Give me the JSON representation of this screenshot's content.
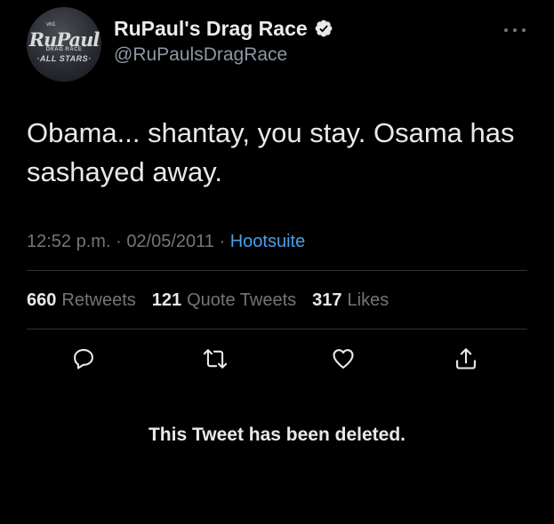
{
  "colors": {
    "background": "#000000",
    "primary_text": "#e7e9ea",
    "secondary_text": "#71767b",
    "link": "#4c9eeb",
    "divider": "#2f3336"
  },
  "avatar": {
    "logo_top": "RuPaul",
    "logo_mid": "DRAG RACE",
    "logo_bottom": "·ALL STARS·",
    "vh1": "vh1"
  },
  "header": {
    "display_name": "RuPaul's Drag Race",
    "handle": "@RuPaulsDragRace",
    "verified_icon": "verified-badge-icon",
    "more_icon": "more-options-icon"
  },
  "tweet": {
    "text": "Obama... shantay, you stay. Osama has sashayed away.",
    "time": "12:52 p.m.",
    "date": "02/05/2011",
    "separator": "·",
    "source": "Hootsuite"
  },
  "stats": {
    "retweets_count": "660",
    "retweets_label": "Retweets",
    "quotes_count": "121",
    "quotes_label": "Quote Tweets",
    "likes_count": "317",
    "likes_label": "Likes"
  },
  "actions": {
    "reply_icon": "reply-icon",
    "retweet_icon": "retweet-icon",
    "like_icon": "like-icon",
    "share_icon": "share-icon"
  },
  "notice": {
    "deleted_text": "This Tweet has been deleted."
  }
}
